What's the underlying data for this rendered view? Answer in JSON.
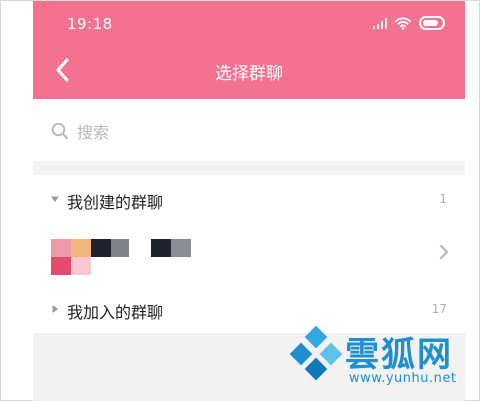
{
  "status_bar": {
    "time": "19:18"
  },
  "nav": {
    "title": "选择群聊"
  },
  "search": {
    "placeholder": "搜索"
  },
  "groups": [
    {
      "label": "我创建的群聊",
      "count": "1",
      "expanded": true
    },
    {
      "label": "我加入的群聊",
      "count": "17",
      "expanded": false
    }
  ],
  "colors": {
    "header": "#f3728f",
    "section_bg": "#f2f2f2",
    "text_primary": "#222222",
    "text_muted": "#b0b0b0",
    "watermark": "#1f8fcf"
  },
  "icons": {
    "back": "chevron-left-icon",
    "search": "search-icon",
    "expanded": "triangle-down-icon",
    "collapsed": "triangle-right-icon",
    "open": "chevron-right-icon",
    "wifi": "wifi-icon",
    "signal": "signal-icon",
    "battery": "battery-icon"
  },
  "watermark": {
    "title": "雲狐网",
    "url": "www.yunhu.net"
  }
}
